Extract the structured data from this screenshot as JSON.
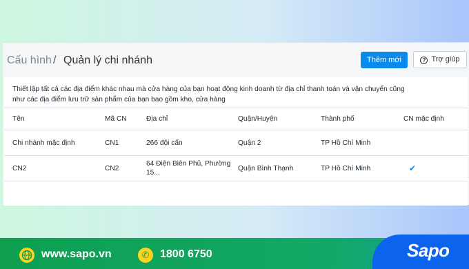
{
  "breadcrumb": {
    "root": "Cấu hình",
    "separator": "/",
    "current": "Quản lý chi nhánh"
  },
  "actions": {
    "add_label": "Thêm mới",
    "help_label": "Trợ giúp"
  },
  "description": "Thiết lập tất cả các địa điểm khác nhau mà cửa hàng của bạn hoạt động kinh doanh từ địa chỉ thanh toán và vận chuyển cũng như các địa điểm lưu trữ sản phẩm của bạn bao gồm kho, cửa hàng",
  "table": {
    "headers": [
      "Tên",
      "Mã CN",
      "Địa chỉ",
      "Quận/Huyện",
      "Thành phố",
      "CN mặc định"
    ],
    "rows": [
      [
        "Chi nhánh mặc định",
        "CN1",
        "266 đội cấn",
        "Quận 2",
        "TP Hồ Chí Minh",
        ""
      ],
      [
        "CN2",
        "CN2",
        "64 Điện Biên Phủ, Phường 15...",
        "Quận Bình Thạnh",
        "TP Hồ Chí Minh",
        "✔"
      ]
    ]
  },
  "footer": {
    "website": "www.sapo.vn",
    "phone": "1800 6750",
    "logo": "Sapo"
  },
  "colors": {
    "primary": "#0a8aed",
    "footer_green": "#0e9f50",
    "footer_blue": "#0b63ee"
  }
}
